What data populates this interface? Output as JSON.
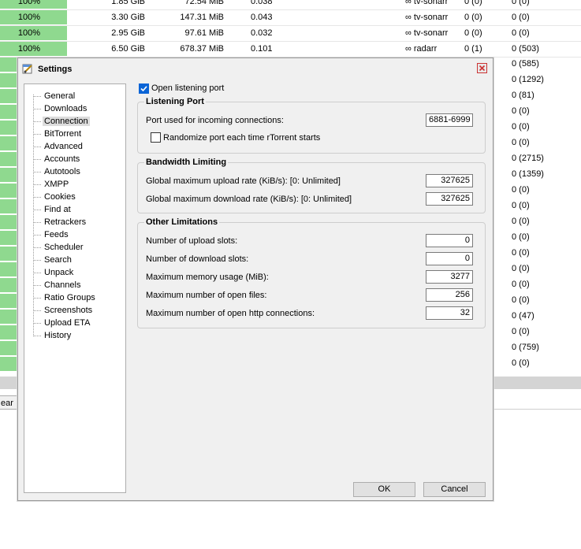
{
  "background_rows": [
    {
      "progress": "100%",
      "size": "1.85 GiB",
      "downloaded": "72.54 MiB",
      "ratio": "0.038",
      "label": "∞  tv-sonarr",
      "seeds": "0 (0)",
      "peers": "0 (0)"
    },
    {
      "progress": "100%",
      "size": "3.30 GiB",
      "downloaded": "147.31 MiB",
      "ratio": "0.043",
      "label": "∞  tv-sonarr",
      "seeds": "0 (0)",
      "peers": "0 (0)"
    },
    {
      "progress": "100%",
      "size": "2.95 GiB",
      "downloaded": "97.61 MiB",
      "ratio": "0.032",
      "label": "∞  tv-sonarr",
      "seeds": "0 (0)",
      "peers": "0 (0)"
    },
    {
      "progress": "100%",
      "size": "6.50 GiB",
      "downloaded": "678.37 MiB",
      "ratio": "0.101",
      "label": "∞  radarr",
      "seeds": "0 (1)",
      "peers": "0 (503)"
    }
  ],
  "right_peers": [
    "0 (585)",
    "0 (1292)",
    "0 (81)",
    "0 (0)",
    "0 (0)",
    "0 (0)",
    "0 (2715)",
    "0 (1359)",
    "0 (0)",
    "0 (0)",
    "0 (0)",
    "0 (0)",
    "0 (0)",
    "0 (0)",
    "0 (0)",
    "0 (0)",
    "0 (47)",
    "0 (0)",
    "0 (759)",
    "0 (0)"
  ],
  "clear_button": "ear",
  "dialog": {
    "title": "Settings",
    "tree": [
      "General",
      "Downloads",
      "Connection",
      "BitTorrent",
      "Advanced",
      "Accounts",
      "Autotools",
      "XMPP",
      "Cookies",
      "Find at",
      "Retrackers",
      "Feeds",
      "Scheduler",
      "Search",
      "Unpack",
      "Channels",
      "Ratio Groups",
      "Screenshots",
      "Upload ETA",
      "History"
    ],
    "selected": "Connection",
    "open_port_label": "Open listening port",
    "listening_port": {
      "legend": "Listening Port",
      "port_label": "Port used for incoming connections:",
      "port_value": "6881-6999",
      "randomize_label": "Randomize port each time rTorrent starts"
    },
    "bandwidth": {
      "legend": "Bandwidth Limiting",
      "upload_label": "Global maximum upload rate (KiB/s): [0: Unlimited]",
      "upload_value": "327625",
      "download_label": "Global maximum download rate (KiB/s): [0: Unlimited]",
      "download_value": "327625"
    },
    "other": {
      "legend": "Other Limitations",
      "upload_slots_label": "Number of upload slots:",
      "upload_slots_value": "0",
      "download_slots_label": "Number of download slots:",
      "download_slots_value": "0",
      "memory_label": "Maximum memory usage (MiB):",
      "memory_value": "3277",
      "open_files_label": "Maximum number of open files:",
      "open_files_value": "256",
      "http_label": "Maximum number of open http connections:",
      "http_value": "32"
    },
    "ok": "OK",
    "cancel": "Cancel"
  },
  "colors": {
    "progress_green": "#8fd98f",
    "checkbox_blue": "#0a64d6",
    "close_red": "#cc3333"
  }
}
